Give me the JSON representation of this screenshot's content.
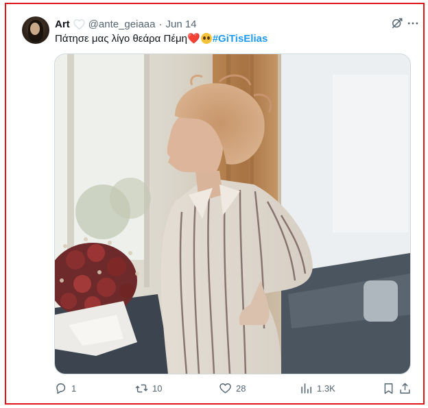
{
  "tweet": {
    "display_name": "Art",
    "handle": "@ante_geiaaa",
    "separator": "·",
    "date": "Jun 14",
    "text_main": "Πάτησε μας λίγο θεάρα Πέμη",
    "emoji_heart": "❤️",
    "hashtag": "#GiTisElias"
  },
  "actions": {
    "replies": "1",
    "retweets": "10",
    "likes": "28",
    "views": "1.3K"
  },
  "icons": {
    "grok": "grok-icon",
    "more": "more-icon",
    "reply": "reply-icon",
    "retweet": "retweet-icon",
    "like": "heart-icon",
    "views": "views-icon",
    "bookmark": "bookmark-icon",
    "share": "share-icon"
  },
  "colors": {
    "accent": "#1d9bf0",
    "frame": "#e0151a",
    "secondary_text": "#536471"
  }
}
